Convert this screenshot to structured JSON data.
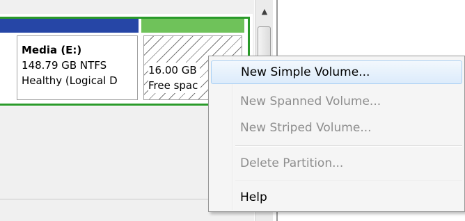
{
  "disk": {
    "partitions": [
      {
        "name": "Media  (E:)",
        "size_fs": "148.79 GB NTFS",
        "status": "Healthy (Logical D",
        "bar_color": "#2646a6"
      },
      {
        "size": "16.00 GB",
        "status": "Free spac",
        "bar_color": "#6fc25a"
      }
    ],
    "extended_frame_color": "#2a9a2a"
  },
  "scrollbar": {
    "up_icon": "scroll-up-arrow"
  },
  "context_menu": {
    "items": [
      {
        "label": "New Simple Volume...",
        "enabled": true,
        "highlighted": true
      },
      {
        "label": "New Spanned Volume...",
        "enabled": false
      },
      {
        "label": "New Striped Volume...",
        "enabled": false
      },
      {
        "label": "Delete Partition...",
        "enabled": false
      },
      {
        "label": "Help",
        "enabled": true
      }
    ]
  }
}
